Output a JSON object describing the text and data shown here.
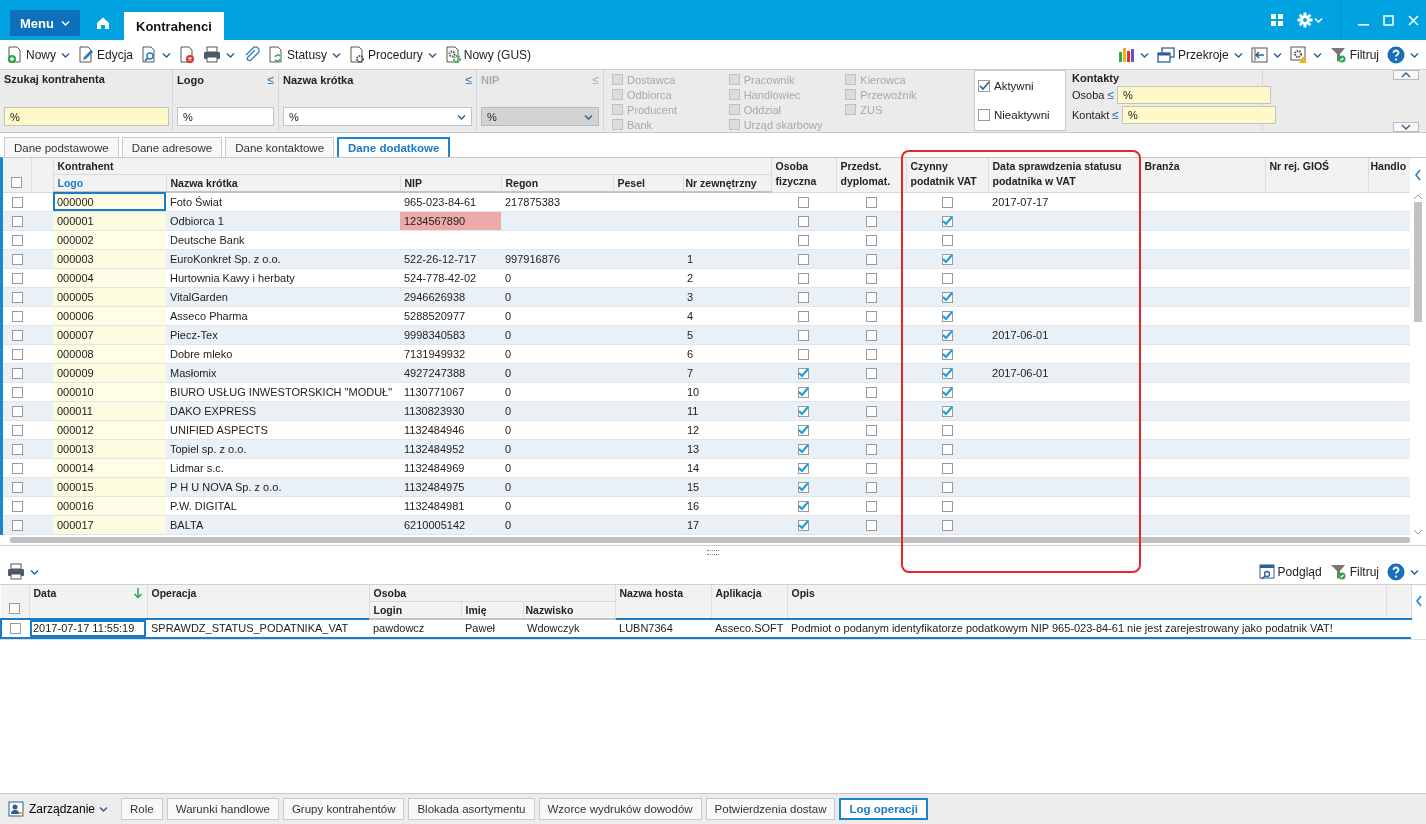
{
  "title_bar": {
    "menu": "Menu",
    "tabs": [
      {
        "label": "Kontrahenci",
        "selected": true
      }
    ]
  },
  "toolbar": {
    "left": [
      {
        "label": "Nowy",
        "dropdown": true
      },
      {
        "label": "Edycja",
        "dropdown": false
      },
      {
        "dropdown": true
      },
      {
        "dropdown": false
      },
      {
        "dropdown": true
      },
      {
        "dropdown": false
      },
      {
        "label": "Statusy",
        "dropdown": true
      },
      {
        "label": "Procedury",
        "dropdown": true
      },
      {
        "label": "Nowy (GUS)",
        "dropdown": false
      }
    ],
    "right": [
      {
        "dropdown": true
      },
      {
        "label": "Przekroje",
        "dropdown": true
      },
      {
        "dropdown": true
      },
      {
        "dropdown": true
      },
      {
        "label": "Filtruj",
        "dropdown": false
      },
      {
        "dropdown": true
      }
    ]
  },
  "filters": {
    "search": {
      "label": "Szukaj kontrahenta",
      "value": "%"
    },
    "logo": {
      "label": "Logo",
      "operator": "≤",
      "value": "%",
      "disabled": false
    },
    "short_name": {
      "label": "Nazwa krótka",
      "operator": "≤",
      "value": "%",
      "disabled": false
    },
    "nip": {
      "label": "NIP",
      "operator": "≤",
      "value": "%",
      "disabled": true
    },
    "types": [
      [
        {
          "label": "Dostawca",
          "checked": false,
          "disabled": true
        },
        {
          "label": "Odbiorca",
          "checked": false,
          "disabled": true
        },
        {
          "label": "Producent",
          "checked": false,
          "disabled": true
        },
        {
          "label": "Bank",
          "checked": false,
          "disabled": true
        }
      ],
      [
        {
          "label": "Pracownik",
          "checked": false,
          "disabled": true
        },
        {
          "label": "Handlowiec",
          "checked": false,
          "disabled": true
        },
        {
          "label": "Oddział",
          "checked": false,
          "disabled": true
        },
        {
          "label": "Urząd skarbowy",
          "checked": false,
          "disabled": true
        }
      ],
      [
        {
          "label": "Kierowca",
          "checked": false,
          "disabled": true
        },
        {
          "label": "Przewoźnik",
          "checked": false,
          "disabled": true
        },
        {
          "label": "ZUS",
          "checked": false,
          "disabled": true
        }
      ]
    ],
    "status": [
      {
        "label": "Aktywni",
        "checked": true
      },
      {
        "label": "Nieaktywni",
        "checked": false
      }
    ],
    "contacts": {
      "title": "Kontakty",
      "fields": [
        {
          "label": "Osoba",
          "operator": "≤",
          "value": "%"
        },
        {
          "label": "Kontakt",
          "operator": "≤",
          "value": "%"
        }
      ]
    }
  },
  "view_tabs": [
    {
      "label": "Dane podstawowe",
      "selected": false
    },
    {
      "label": "Dane adresowe",
      "selected": false
    },
    {
      "label": "Dane kontaktowe",
      "selected": false
    },
    {
      "label": "Dane dodatkowe",
      "selected": true
    }
  ],
  "grid": {
    "all_checked": false,
    "group": {
      "label": "Kontrahent",
      "columns": [
        {
          "label": "Logo",
          "active": true
        },
        {
          "label": "Nazwa krótka",
          "active": false
        },
        {
          "label": "NIP",
          "active": false
        },
        {
          "label": "Regon",
          "active": false
        },
        {
          "label": "Pesel",
          "active": false
        },
        {
          "label": "Nr zewnętrzny",
          "active": false
        }
      ]
    },
    "columns": [
      {
        "label": "Osoba fizyczna",
        "active": false
      },
      {
        "label": "Przedst. dyplomat.",
        "active": false
      },
      {
        "label": "Czynny podatnik VAT",
        "active": false
      },
      {
        "label": "Data sprawdzenia statusu podatnika w VAT",
        "active": false
      },
      {
        "label": "Branża",
        "active": false
      },
      {
        "label": "Nr rej. GIOŚ",
        "active": false
      },
      {
        "label": "Handlo",
        "active": false
      }
    ],
    "rows": [
      {
        "checked": false,
        "focused": true,
        "logo": "000000",
        "name": "Foto Świat",
        "nip": "965-023-84-61",
        "nip_error": false,
        "regon": "217875383",
        "osoba_fizyczna": false,
        "przedst_dyplomat": false,
        "czynny_vat": false,
        "data_vat": "2017-07-17"
      },
      {
        "checked": false,
        "focused": false,
        "logo": "000001",
        "name": "Odbiorca 1",
        "nip": "1234567890",
        "nip_error": true,
        "osoba_fizyczna": false,
        "przedst_dyplomat": false,
        "czynny_vat": true
      },
      {
        "checked": false,
        "focused": false,
        "logo": "000002",
        "name": "Deutsche Bank",
        "nip_error": false,
        "osoba_fizyczna": false,
        "przedst_dyplomat": false,
        "czynny_vat": false
      },
      {
        "checked": false,
        "focused": false,
        "logo": "000003",
        "name": "EuroKonkret Sp. z o.o.",
        "nip": "522-26-12-717",
        "nip_error": false,
        "regon": "997916876",
        "nr": "1",
        "osoba_fizyczna": false,
        "przedst_dyplomat": false,
        "czynny_vat": true
      },
      {
        "checked": false,
        "focused": false,
        "logo": "000004",
        "name": "Hurtownia Kawy i herbaty",
        "nip": "524-778-42-02",
        "nip_error": false,
        "regon": "0",
        "nr": "2",
        "osoba_fizyczna": false,
        "przedst_dyplomat": false,
        "czynny_vat": false
      },
      {
        "checked": false,
        "focused": false,
        "logo": "000005",
        "name": "VitalGarden",
        "nip": "2946626938",
        "nip_error": false,
        "regon": "0",
        "nr": "3",
        "osoba_fizyczna": false,
        "przedst_dyplomat": false,
        "czynny_vat": true
      },
      {
        "checked": false,
        "focused": false,
        "logo": "000006",
        "name": "Asseco Pharma",
        "nip": "5288520977",
        "nip_error": false,
        "regon": "0",
        "nr": "4",
        "osoba_fizyczna": false,
        "przedst_dyplomat": false,
        "czynny_vat": true
      },
      {
        "checked": false,
        "focused": false,
        "logo": "000007",
        "name": "Piecz-Tex",
        "nip": "9998340583",
        "nip_error": false,
        "regon": "0",
        "nr": "5",
        "osoba_fizyczna": false,
        "przedst_dyplomat": false,
        "czynny_vat": true,
        "data_vat": "2017-06-01"
      },
      {
        "checked": false,
        "focused": false,
        "logo": "000008",
        "name": "Dobre mleko",
        "nip": "7131949932",
        "nip_error": false,
        "regon": "0",
        "nr": "6",
        "osoba_fizyczna": false,
        "przedst_dyplomat": false,
        "czynny_vat": true
      },
      {
        "checked": false,
        "focused": false,
        "logo": "000009",
        "name": "Masłomix",
        "nip": "4927247388",
        "nip_error": false,
        "regon": "0",
        "nr": "7",
        "osoba_fizyczna": true,
        "przedst_dyplomat": false,
        "czynny_vat": true,
        "data_vat": "2017-06-01"
      },
      {
        "checked": false,
        "focused": false,
        "logo": "000010",
        "name": "BIURO USŁUG INWESTORSKICH \"MODUŁ\"",
        "nip": "1130771067",
        "nip_error": false,
        "regon": "0",
        "nr": "10",
        "osoba_fizyczna": true,
        "przedst_dyplomat": false,
        "czynny_vat": true
      },
      {
        "checked": false,
        "focused": false,
        "logo": "000011",
        "name": "DAKO EXPRESS",
        "nip": "1130823930",
        "nip_error": false,
        "regon": "0",
        "nr": "11",
        "osoba_fizyczna": true,
        "przedst_dyplomat": false,
        "czynny_vat": true
      },
      {
        "checked": false,
        "focused": false,
        "logo": "000012",
        "name": "UNIFIED ASPECTS",
        "nip": "1132484946",
        "nip_error": false,
        "regon": "0",
        "nr": "12",
        "osoba_fizyczna": true,
        "przedst_dyplomat": false,
        "czynny_vat": false
      },
      {
        "checked": false,
        "focused": false,
        "logo": "000013",
        "name": "Topiel sp. z o.o.",
        "nip": "1132484952",
        "nip_error": false,
        "regon": "0",
        "nr": "13",
        "osoba_fizyczna": true,
        "przedst_dyplomat": false,
        "czynny_vat": false
      },
      {
        "checked": false,
        "focused": false,
        "logo": "000014",
        "name": "Lidmar s.c.",
        "nip": "1132484969",
        "nip_error": false,
        "regon": "0",
        "nr": "14",
        "osoba_fizyczna": true,
        "przedst_dyplomat": false,
        "czynny_vat": false
      },
      {
        "checked": false,
        "focused": false,
        "logo": "000015",
        "name": "P H U NOVA Sp. z o.o.",
        "nip": "1132484975",
        "nip_error": false,
        "regon": "0",
        "nr": "15",
        "osoba_fizyczna": true,
        "przedst_dyplomat": false,
        "czynny_vat": false
      },
      {
        "checked": false,
        "focused": false,
        "logo": "000016",
        "name": "P.W. DIGITAL",
        "nip": "1132484981",
        "nip_error": false,
        "regon": "0",
        "nr": "16",
        "osoba_fizyczna": true,
        "przedst_dyplomat": false,
        "czynny_vat": false
      },
      {
        "checked": false,
        "focused": false,
        "logo": "000017",
        "name": "BALTA",
        "nip": "6210005142",
        "nip_error": false,
        "regon": "0",
        "nr": "17",
        "osoba_fizyczna": true,
        "przedst_dyplomat": false,
        "czynny_vat": false
      }
    ]
  },
  "log_toolbar": {
    "left": [
      {
        "dropdown": true
      }
    ],
    "right": [
      {
        "label": "Podgląd",
        "dropdown": false
      },
      {
        "label": "Filtruj",
        "dropdown": false
      },
      {
        "dropdown": true
      }
    ]
  },
  "log_grid": {
    "all_checked": false,
    "columns": [
      {
        "label": "Data",
        "sorted_desc": true
      },
      {
        "label": "Operacja",
        "sorted_desc": false
      }
    ],
    "group": {
      "label": "Osoba",
      "columns": [
        {
          "label": "Login"
        },
        {
          "label": "Imię"
        },
        {
          "label": "Nazwisko"
        }
      ]
    },
    "columns_after": [
      {
        "label": "Nazwa hosta"
      },
      {
        "label": "Aplikacja"
      },
      {
        "label": "Opis"
      }
    ],
    "rows": [
      {
        "checked": false,
        "selected": true,
        "data": "2017-07-17 11:55:19",
        "operacja": "SPRAWDZ_STATUS_PODATNIKA_VAT",
        "login": "pawdowcz",
        "imie": "Paweł",
        "nazwisko": "Wdowczyk",
        "host": "LUBN7364",
        "aplikacja": "Asseco.SOFT",
        "opis": "Podmiot o podanym identyfikatorze podatkowym NIP 965-023-84-61 nie jest zarejestrowany jako podatnik VAT!"
      }
    ]
  },
  "bottom_tabs": {
    "menu": {
      "label": "Zarządzanie",
      "dropdown": true
    },
    "tabs": [
      {
        "label": "Role",
        "selected": false
      },
      {
        "label": "Warunki handlowe",
        "selected": false
      },
      {
        "label": "Grupy kontrahentów",
        "selected": false
      },
      {
        "label": "Blokada asortymentu",
        "selected": false
      },
      {
        "label": "Wzorce wydruków dowodów",
        "selected": false
      },
      {
        "label": "Potwierdzenia dostaw",
        "selected": false
      },
      {
        "label": "Log operacji",
        "selected": true
      }
    ]
  }
}
